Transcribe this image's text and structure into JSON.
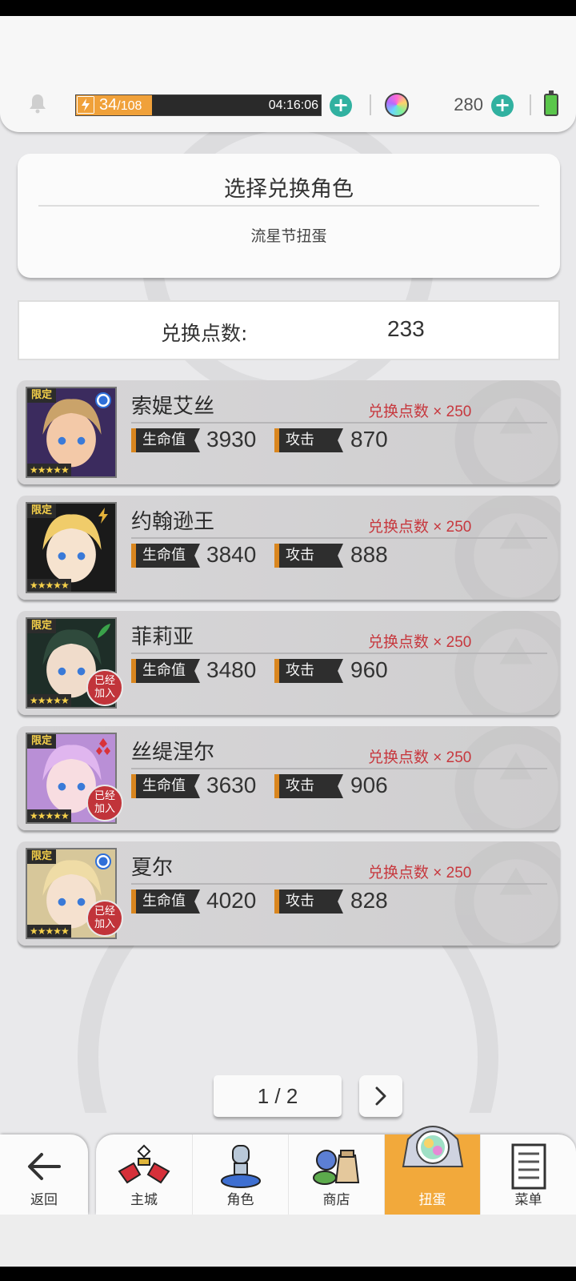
{
  "status": {
    "stamina_current": "34",
    "stamina_max": "/108",
    "stamina_fraction": 0.31,
    "timer": "04:16:06",
    "gems": "280"
  },
  "header": {
    "title": "选择兑换角色",
    "subtitle": "流星节扭蛋"
  },
  "points": {
    "label": "兑换点数:",
    "value": "233"
  },
  "labels": {
    "limited": "限定",
    "stars": "★★★★★",
    "hp": "生命值",
    "atk": "攻击",
    "joined_line1": "已经",
    "joined_line2": "加入"
  },
  "characters": [
    {
      "name": "索媞艾丝",
      "cost": "兑换点数 × 250",
      "hp": "3930",
      "atk": "870",
      "element": "water-icon",
      "joined": false,
      "palette": [
        "#3b2b5e",
        "#caa36a",
        "#f3c9a8"
      ]
    },
    {
      "name": "约翰逊王",
      "cost": "兑换点数 × 250",
      "hp": "3840",
      "atk": "888",
      "element": "lightning-icon",
      "joined": false,
      "palette": [
        "#1a1a1a",
        "#f0cc6a",
        "#f6e3cf"
      ]
    },
    {
      "name": "菲莉亚",
      "cost": "兑换点数 × 250",
      "hp": "3480",
      "atk": "960",
      "element": "leaf-icon",
      "joined": true,
      "palette": [
        "#1e2e28",
        "#2f4a3c",
        "#f0dccb"
      ]
    },
    {
      "name": "丝缇涅尔",
      "cost": "兑换点数 × 250",
      "hp": "3630",
      "atk": "906",
      "element": "fire-icon",
      "joined": true,
      "palette": [
        "#b98fd6",
        "#e0b6ef",
        "#f8dde1"
      ]
    },
    {
      "name": "夏尔",
      "cost": "兑换点数 × 250",
      "hp": "4020",
      "atk": "828",
      "element": "water-icon",
      "joined": true,
      "palette": [
        "#d7c79a",
        "#efdca6",
        "#f5e1cf"
      ]
    }
  ],
  "pagination": {
    "text": "1 / 2"
  },
  "nav": {
    "back": "返回",
    "items": [
      {
        "label": "主城",
        "icon": "castle-icon"
      },
      {
        "label": "角色",
        "icon": "character-icon"
      },
      {
        "label": "商店",
        "icon": "shop-icon"
      },
      {
        "label": "扭蛋",
        "icon": "gacha-icon",
        "active": true
      },
      {
        "label": "菜单",
        "icon": "menu-icon"
      }
    ]
  },
  "colors": {
    "accent": "#f2a93b",
    "plus": "#31b1a0",
    "cost_red": "#c7383e",
    "joined_badge": "#c1343a"
  }
}
